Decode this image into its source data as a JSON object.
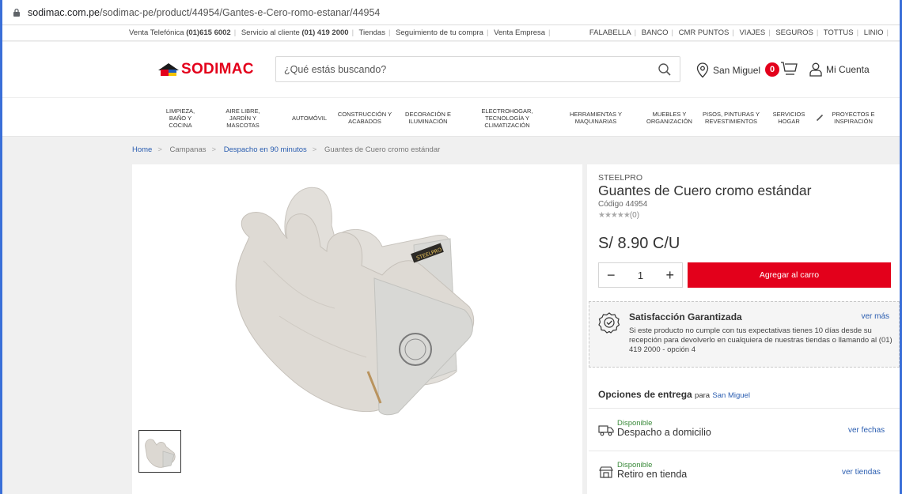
{
  "browser": {
    "url_host": "sodimac.com.pe",
    "url_path": "/sodimac-pe/product/44954/Gantes-e-Cero-romo-estanar/44954"
  },
  "topbar": {
    "left": [
      {
        "pre": "Venta Telefónica ",
        "bold": "(01)615 6002"
      },
      {
        "pre": "Servicio al cliente ",
        "bold": "(01) 419 2000"
      },
      {
        "pre": "Tiendas",
        "bold": ""
      },
      {
        "pre": "Seguimiento de tu compra",
        "bold": ""
      },
      {
        "pre": "Venta Empresa",
        "bold": ""
      }
    ],
    "right": [
      "FALABELLA",
      "BANCO",
      "CMR PUNTOS",
      "VIAJES",
      "SEGUROS",
      "TOTTUS",
      "LINIO"
    ]
  },
  "header": {
    "logo_text": "SODIMAC",
    "search_placeholder": "¿Qué estás buscando?",
    "location": "San Miguel",
    "cart_count": "0",
    "account": "Mi Cuenta"
  },
  "nav": [
    "LIMPIEZA, BAÑO Y COCINA",
    "AIRE LIBRE, JARDÍN Y MASCOTAS",
    "AUTOMÓVIL",
    "CONSTRUCCIÓN Y ACABADOS",
    "DECORACIÓN E ILUMINACIÓN",
    "ELECTROHOGAR, TECNOLOGÍA Y CLIMATIZACIÓN",
    "HERRAMIENTAS Y MAQUINARIAS",
    "MUEBLES Y ORGANIZACIÓN",
    "PISOS, PINTURAS Y REVESTIMIENTOS",
    "SERVICIOS HOGAR",
    "PROYECTOS E INSPIRACIÓN"
  ],
  "breadcrumb": [
    "Home",
    "Campanas",
    "Despacho en 90 minutos",
    "Guantes de Cuero cromo estándar"
  ],
  "product": {
    "brand": "STEELPRO",
    "title": "Guantes de Cuero cromo estándar",
    "code": "Código 44954",
    "stars": "★★★★★",
    "review_count": "(0)",
    "price": "S/ 8.90 C/U",
    "quantity": "1",
    "add_to_cart": "Agregar al carro",
    "image_label": "STEELPRO"
  },
  "guarantee": {
    "title": "Satisfacción Garantizada",
    "link": "ver más",
    "body": "Si este producto no cumple con tus expectativas tienes 10 días desde su recepción para devolverlo en cualquiera de nuestras tiendas o llamando al (01) 419 2000 - opción 4"
  },
  "delivery": {
    "title": "Opciones de entrega",
    "para": "para",
    "location": "San Miguel",
    "options": [
      {
        "status": "Disponible",
        "name": "Despacho a domicilio",
        "link": "ver fechas"
      },
      {
        "status": "Disponible",
        "name": "Retiro en tienda",
        "link": "ver tiendas"
      }
    ]
  },
  "colors": {
    "brand_red": "#e3001b",
    "link_blue": "#2a5db0",
    "available_green": "#3a8a3a"
  }
}
